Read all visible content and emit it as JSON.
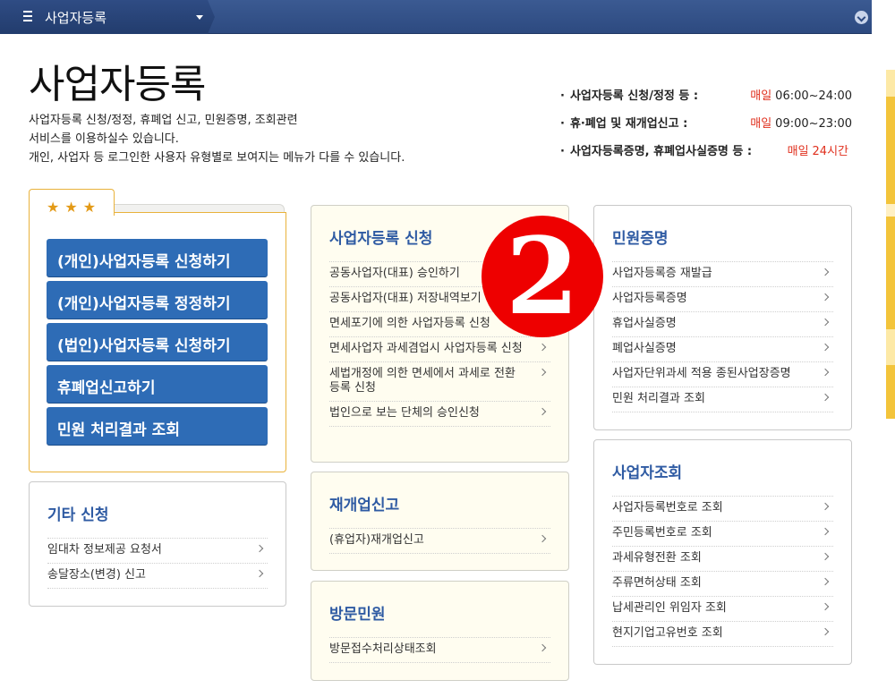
{
  "topbar": {
    "breadcrumb": "사업자등록"
  },
  "header": {
    "title": "사업자등록",
    "desc": [
      "사업자등록 신청/정정, 휴폐업 신고, 민원증명, 조회관련",
      "서비스를 이용하실수 있습니다.",
      "개인, 사업자 등 로그인한 사용자 유형별로 보여지는 메뉴가 다를 수 있습니다."
    ]
  },
  "hours": [
    {
      "label": "사업자등록 신청/정정 등 :",
      "daily": "매일",
      "time": "06:00~24:00"
    },
    {
      "label": "휴·폐업 및 재개업신고 :",
      "daily": "매일",
      "time": "09:00~23:00"
    },
    {
      "label": "사업자등록증명, 휴폐업사실증명 등 :",
      "daily": "매일",
      "time": "24시간"
    }
  ],
  "favorites": {
    "stars": "★★★",
    "buttons": [
      "(개인)사업자등록 신청하기",
      "(개인)사업자등록 정정하기",
      "(법인)사업자등록 신청하기",
      "휴폐업신고하기",
      "민원 처리결과 조회"
    ]
  },
  "other": {
    "title": "기타 신청",
    "items": [
      "임대차 정보제공 요청서",
      "송달장소(변경) 신고"
    ]
  },
  "register": {
    "title": "사업자등록 신청",
    "items": [
      "공동사업자(대표) 승인하기",
      "공동사업자(대표) 저장내역보기",
      "면세포기에 의한 사업자등록 신청",
      "면세사업자 과세겸업시 사업자등록 신청",
      "세법개정에 의한 면세에서 과세로 전환 등록 신청",
      "법인으로 보는 단체의 승인신청"
    ]
  },
  "reopen": {
    "title": "재개업신고",
    "items": [
      "(휴업자)재개업신고"
    ]
  },
  "visit": {
    "title": "방문민원",
    "items": [
      "방문접수처리상태조회"
    ]
  },
  "cert": {
    "title": "민원증명",
    "items": [
      "사업자등록증 재발급",
      "사업자등록증명",
      "휴업사실증명",
      "폐업사실증명",
      "사업자단위과세 적용 종된사업장증명",
      "민원 처리결과 조회"
    ]
  },
  "lookup": {
    "title": "사업자조회",
    "items": [
      "사업자등록번호로 조회",
      "주민등록번호로 조회",
      "과세유형전환 조회",
      "주류면허상태 조회",
      "납세관리인 위임자 조회",
      "현지기업고유번호 조회"
    ]
  },
  "badge": {
    "number": "2",
    "color": "#ee0000"
  },
  "colors": {
    "accent": "#2e6cb6",
    "title_blue": "#2f5ba3",
    "highlight_red": "#e0301e",
    "folder_border": "#e9b23b"
  }
}
